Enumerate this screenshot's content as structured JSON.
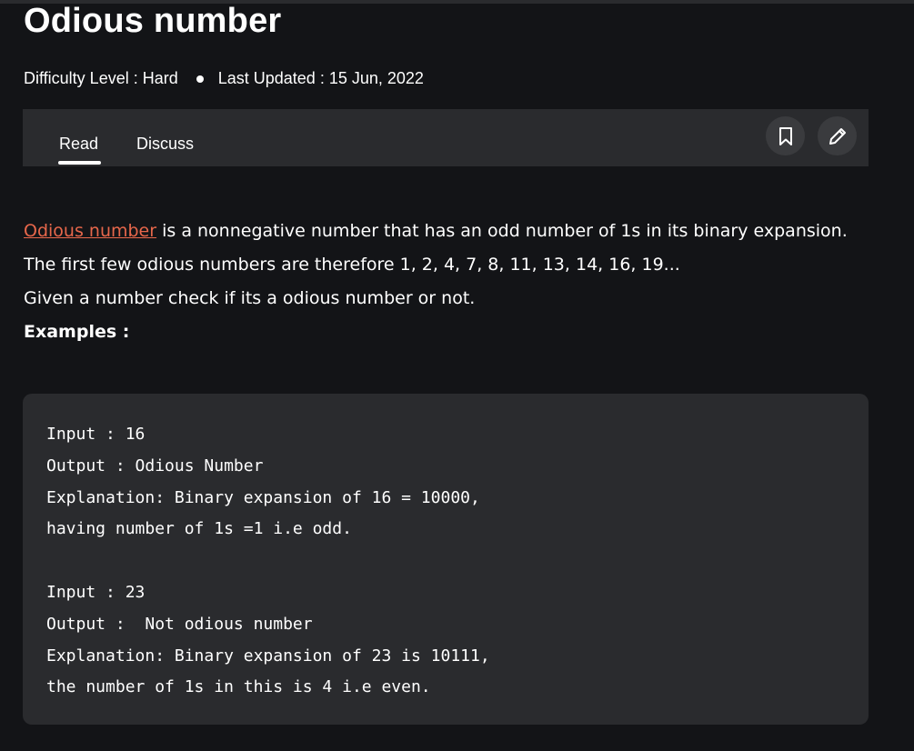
{
  "article": {
    "title": "Odious number",
    "difficulty": "Difficulty Level : Hard",
    "last_updated": "Last Updated : 15 Jun, 2022"
  },
  "tabs": {
    "read": "Read",
    "discuss": "Discuss",
    "active": "Read"
  },
  "actions": {
    "bookmark_icon": "bookmark-icon",
    "edit_icon": "pencil-icon"
  },
  "body": {
    "link_text": "Odious number",
    "line1_rest": " is a nonnegative number that has an odd number of 1s in its binary expansion.",
    "line2": "The first few odious numbers are therefore 1, 2, 4, 7, 8, 11, 13, 14, 16, 19...",
    "line3": "Given a number check if its a odious number or not.",
    "examples_heading": "Examples :"
  },
  "code": {
    "lines": [
      "Input : 16",
      "Output : Odious Number",
      "Explanation: Binary expansion of 16 = 10000,",
      "having number of 1s =1 i.e odd.",
      "",
      "Input : 23",
      "Output :  Not odious number",
      "Explanation: Binary expansion of 23 is 10111,",
      "the number of 1s in this is 4 i.e even."
    ]
  },
  "colors": {
    "background": "#131417",
    "panel": "#2a2b2e",
    "link": "#e7674b",
    "text": "#ffffff"
  }
}
